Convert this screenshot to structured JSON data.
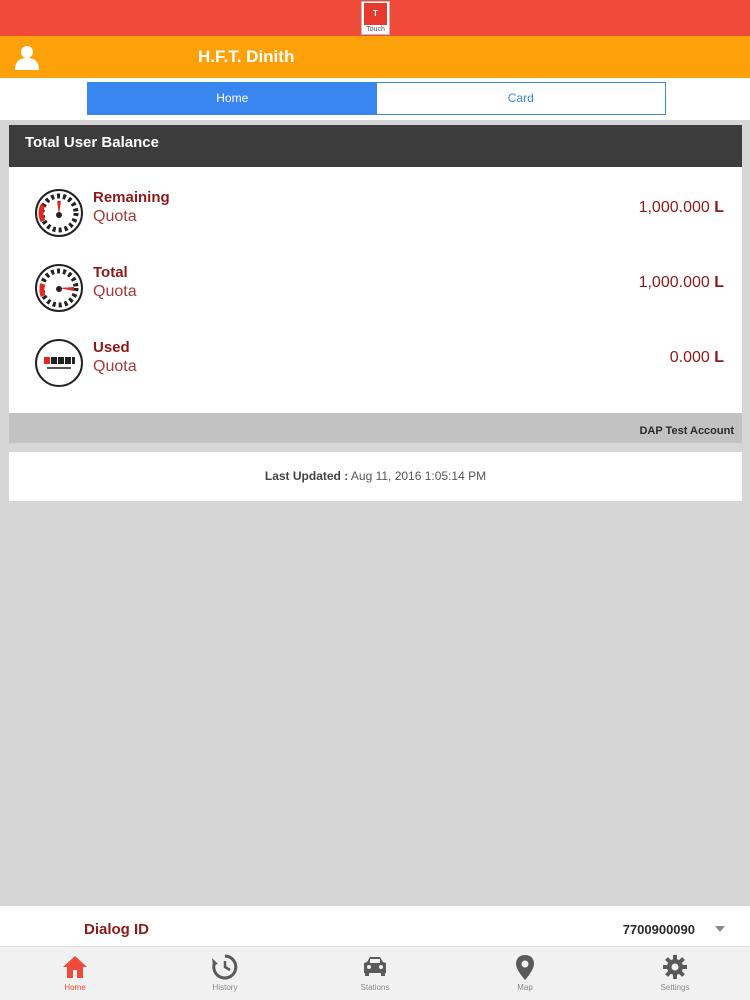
{
  "app": {
    "logo_mark": "T",
    "logo_text": "Touch"
  },
  "user": {
    "name": "H.F.T. Dinith"
  },
  "tabs": [
    {
      "label": "Home",
      "active": true
    },
    {
      "label": "Card",
      "active": false
    }
  ],
  "balance": {
    "title": "Total User Balance",
    "rows": [
      {
        "label_top": "Remaining",
        "label_bottom": "Quota",
        "value": "1,000.000",
        "unit": "L",
        "icon": "gauge-full-icon"
      },
      {
        "label_top": "Total",
        "label_bottom": "Quota",
        "value": "1,000.000",
        "unit": "L",
        "icon": "gauge-icon"
      },
      {
        "label_top": "Used",
        "label_bottom": "Quota",
        "value": "0.000",
        "unit": "L",
        "icon": "odometer-icon"
      }
    ],
    "account_name": "DAP Test Account"
  },
  "last_updated": {
    "label": "Last Updated :",
    "value": "Aug 11, 2016 1:05:14 PM"
  },
  "dialog": {
    "label": "Dialog ID",
    "value": "7700900090"
  },
  "nav": [
    {
      "label": "Home",
      "icon": "home-icon",
      "active": true
    },
    {
      "label": "History",
      "icon": "history-icon",
      "active": false
    },
    {
      "label": "Stations",
      "icon": "car-icon",
      "active": false
    },
    {
      "label": "Map",
      "icon": "map-pin-icon",
      "active": false
    },
    {
      "label": "Settings",
      "icon": "gear-icon",
      "active": false
    }
  ],
  "colors": {
    "top_bar": "#ef4a3a",
    "user_bar": "#fda10a",
    "tab_active": "#3a86f0",
    "accent_text": "#8b1a1a"
  }
}
